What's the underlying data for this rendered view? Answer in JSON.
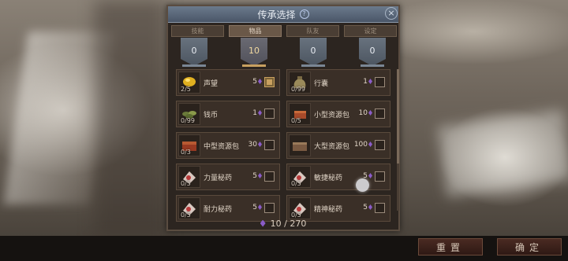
{
  "dialog": {
    "title": "传承选择",
    "help_icon": "?",
    "close_icon": "×"
  },
  "tabs": [
    {
      "label": "技能",
      "active": false
    },
    {
      "label": "物品",
      "active": true
    },
    {
      "label": "队友",
      "active": false
    },
    {
      "label": "设定",
      "active": false
    }
  ],
  "banners": [
    {
      "value": "0",
      "style": "silver"
    },
    {
      "value": "10",
      "style": "gold"
    },
    {
      "value": "0",
      "style": "silver"
    },
    {
      "value": "0",
      "style": "silver"
    }
  ],
  "items": [
    {
      "name": "声望",
      "count": "2/5",
      "cost": "5",
      "checked": true,
      "icon": "gold-nugget-icon"
    },
    {
      "name": "行囊",
      "count": "0/99",
      "cost": "1",
      "checked": false,
      "icon": "bag-icon"
    },
    {
      "name": "钱币",
      "count": "0/99",
      "cost": "1",
      "checked": false,
      "icon": "coins-icon"
    },
    {
      "name": "小型资源包",
      "count": "0/5",
      "cost": "10",
      "checked": false,
      "icon": "small-pack-icon"
    },
    {
      "name": "中型资源包",
      "count": "0/3",
      "cost": "30",
      "checked": false,
      "icon": "medium-pack-icon"
    },
    {
      "name": "大型资源包",
      "count": "",
      "cost": "100",
      "checked": false,
      "icon": "large-pack-icon"
    },
    {
      "name": "力量秘药",
      "count": "0/5",
      "cost": "5",
      "checked": false,
      "icon": "potion-icon"
    },
    {
      "name": "敏捷秘药",
      "count": "0/5",
      "cost": "5",
      "checked": false,
      "icon": "potion-icon"
    },
    {
      "name": "耐力秘药",
      "count": "0/5",
      "cost": "5",
      "checked": false,
      "icon": "potion-icon"
    },
    {
      "name": "精神秘药",
      "count": "0/5",
      "cost": "5",
      "checked": false,
      "icon": "potion-icon"
    }
  ],
  "footer": {
    "points": "10 / 270"
  },
  "buttons": {
    "reset": "重置",
    "confirm": "确定"
  },
  "colors": {
    "accent_gold": "#c8a060",
    "gem_purple": "#8a5cc8",
    "title_blue": "#5a6878"
  }
}
